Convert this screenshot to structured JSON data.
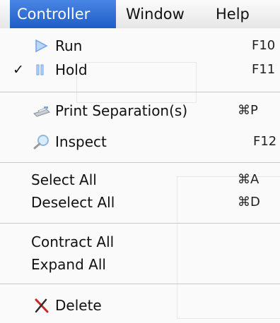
{
  "menubar": {
    "items": [
      {
        "label": "Controller",
        "active": true
      },
      {
        "label": "Window",
        "active": false
      },
      {
        "label": "Help",
        "active": false
      }
    ]
  },
  "menu": {
    "run": {
      "label": "Run",
      "shortcut": "F10",
      "icon": "play-icon"
    },
    "hold": {
      "label": "Hold",
      "shortcut": "F11",
      "icon": "pause-icon",
      "checked": true,
      "check_mark": "✓"
    },
    "print_separations": {
      "label": "Print Separation(s)",
      "shortcut": "⌘P",
      "icon": "printer-icon"
    },
    "inspect": {
      "label": "Inspect",
      "shortcut": "F12",
      "icon": "magnifier-icon"
    },
    "select_all": {
      "label": "Select All",
      "shortcut": "⌘A"
    },
    "deselect_all": {
      "label": "Deselect All",
      "shortcut": "⌘D"
    },
    "contract_all": {
      "label": "Contract All"
    },
    "expand_all": {
      "label": "Expand All"
    },
    "delete": {
      "label": "Delete",
      "icon": "delete-x-icon"
    }
  },
  "colors": {
    "menu_highlight": "#2f6bd0",
    "play_icon": "#6fa3e8",
    "delete_icon": "#c62828"
  }
}
